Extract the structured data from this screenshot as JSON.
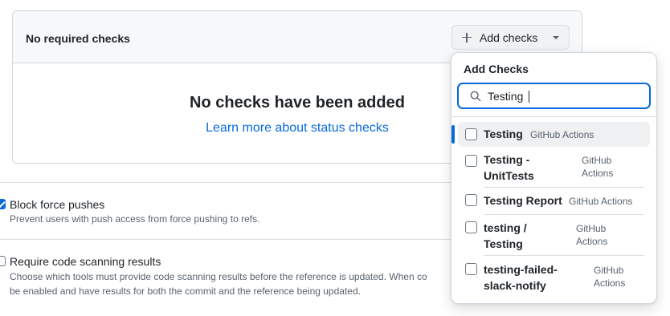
{
  "required_checks": {
    "title": "No required checks",
    "add_button_label": "Add checks",
    "empty_title": "No checks have been added",
    "learn_more_link": "Learn more about status checks"
  },
  "settings": {
    "block_force_pushes": {
      "title": "Block force pushes",
      "description": "Prevent users with push access from force pushing to refs.",
      "checked": true
    },
    "require_code_scanning": {
      "title": "Require code scanning results",
      "description_line1": "Choose which tools must provide code scanning results before the reference is updated. When co",
      "description_line2": "be enabled and have results for both the commit and the reference being updated.",
      "checked": false
    }
  },
  "add_checks_panel": {
    "title": "Add Checks",
    "search_value": "Testing",
    "options": [
      {
        "name_line1": "Testing",
        "name_line2": "",
        "source_line1": "GitHub Actions",
        "source_line2": "",
        "active": true
      },
      {
        "name_line1": "Testing -",
        "name_line2": "UnitTests",
        "source_line1": "GitHub",
        "source_line2": "Actions",
        "active": false
      },
      {
        "name_line1": "Testing Report",
        "name_line2": "",
        "source_line1": "GitHub Actions",
        "source_line2": "",
        "active": false
      },
      {
        "name_line1": "testing /",
        "name_line2": "Testing",
        "source_line1": "GitHub",
        "source_line2": "Actions",
        "active": false
      },
      {
        "name_line1": "testing-failed-",
        "name_line2": "slack-notify",
        "source_line1": "GitHub",
        "source_line2": "Actions",
        "active": false
      }
    ]
  },
  "colors": {
    "accent": "#0969da",
    "border": "#d0d7de",
    "muted_text": "#59636e"
  }
}
